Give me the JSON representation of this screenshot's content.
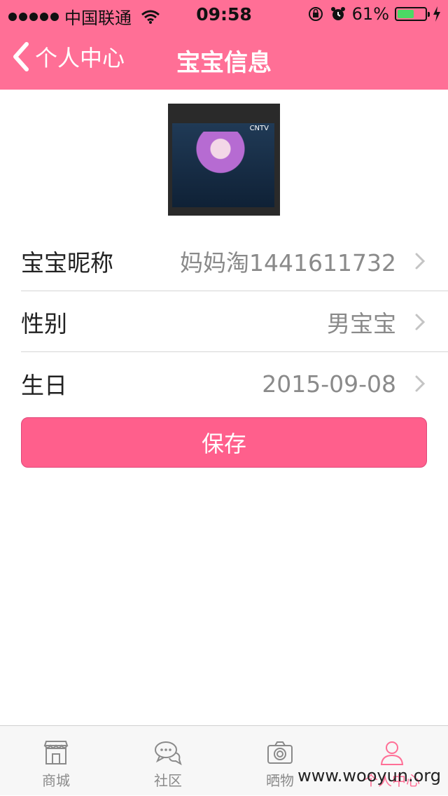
{
  "status_bar": {
    "carrier": "中国联通",
    "time": "09:58",
    "battery_percent": "61%",
    "battery_level": 0.61
  },
  "nav": {
    "back_label": "个人中心",
    "title": "宝宝信息"
  },
  "avatar": {
    "brand_text": "CNTV"
  },
  "fields": {
    "nickname": {
      "label": "宝宝昵称",
      "value": "妈妈淘1441611732"
    },
    "gender": {
      "label": "性别",
      "value": "男宝宝"
    },
    "birthday": {
      "label": "生日",
      "value": "2015-09-08"
    }
  },
  "save_label": "保存",
  "tabs": [
    {
      "label": "商城",
      "icon": "shop-icon"
    },
    {
      "label": "社区",
      "icon": "chat-icon"
    },
    {
      "label": "晒物",
      "icon": "camera-icon"
    },
    {
      "label": "个人中心",
      "icon": "person-icon",
      "active": true
    }
  ],
  "watermark": "www.wooyun.org",
  "colors": {
    "header": "#ff6f96",
    "button": "#ff5f8c",
    "active_tab": "#ff6f96"
  }
}
